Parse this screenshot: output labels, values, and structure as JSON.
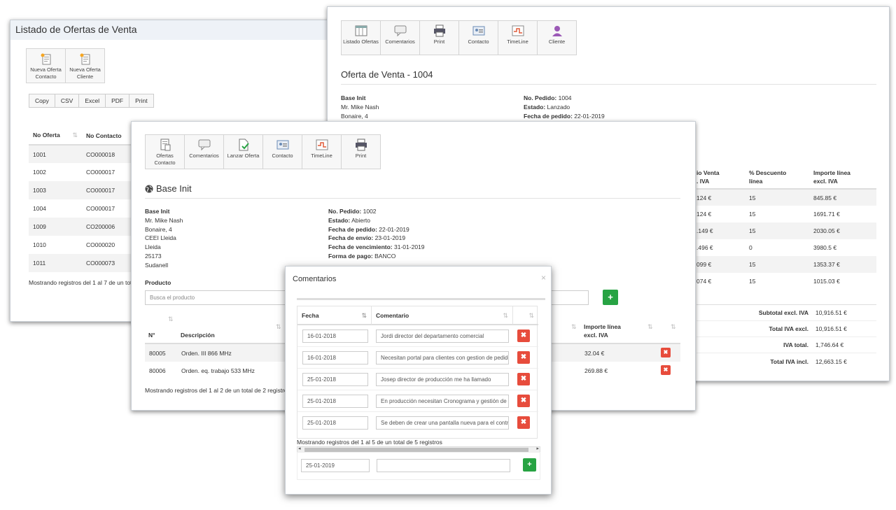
{
  "list_window": {
    "title": "Listado de Ofertas de Venta",
    "toolbar": [
      {
        "label": "Nueva Oferta Contacto",
        "icon": "new-offer-icon"
      },
      {
        "label": "Nueva Oferta Cliente",
        "icon": "new-offer-icon"
      }
    ],
    "export_buttons": [
      "Copy",
      "CSV",
      "Excel",
      "PDF",
      "Print"
    ],
    "columns": [
      "No Oferta",
      "No Contacto"
    ],
    "rows": [
      [
        "1001",
        "CO000018"
      ],
      [
        "1002",
        "CO000017"
      ],
      [
        "1003",
        "CO000017"
      ],
      [
        "1004",
        "CO000017"
      ],
      [
        "1009",
        "CO200006"
      ],
      [
        "1010",
        "CO000020"
      ],
      [
        "1011",
        "CO000073"
      ]
    ],
    "footer": "Mostrando registros del 1 al 7 de un total"
  },
  "offer_window": {
    "toolbar": [
      {
        "label": "Listado Ofertas",
        "icon": "list-icon"
      },
      {
        "label": "Comentarios",
        "icon": "comment-icon"
      },
      {
        "label": "Print",
        "icon": "printer-icon"
      },
      {
        "label": "Contacto",
        "icon": "contact-card-icon"
      },
      {
        "label": "TimeLine",
        "icon": "timeline-icon"
      },
      {
        "label": "Cliente",
        "icon": "user-icon"
      }
    ],
    "title": "Oferta de Venta - 1004",
    "left_info": [
      "Base Init",
      "Mr. Mike Nash",
      "Bonaire, 4"
    ],
    "right_info": [
      {
        "k": "No. Pedido:",
        "v": "1004"
      },
      {
        "k": "Estado:",
        "v": "Lanzado"
      },
      {
        "k": "Fecha de pedido:",
        "v": "22-01-2019"
      }
    ],
    "columns": [
      "io Venta . IVA",
      "% Descuento línea",
      "Importe línea excl. IVA"
    ],
    "col_heads": [
      [
        "io Venta",
        ". IVA"
      ],
      [
        "% Descuento",
        "línea"
      ],
      [
        "Importe línea",
        "excl. IVA"
      ]
    ],
    "rows": [
      [
        "124 €",
        "15",
        "845.85 €"
      ],
      [
        "124 €",
        "15",
        "1691.71 €"
      ],
      [
        ".149 €",
        "15",
        "2030.05 €"
      ],
      [
        ".496 €",
        "0",
        "3980.5 €"
      ],
      [
        "099 €",
        "15",
        "1353.37 €"
      ],
      [
        "074 €",
        "15",
        "1015.03 €"
      ]
    ],
    "totals": [
      {
        "label": "Subtotal excl. IVA",
        "value": "10,916.51 €"
      },
      {
        "label": "Total IVA excl.",
        "value": "10,916.51 €"
      },
      {
        "label": "IVA total.",
        "value": "1,746.64 €"
      },
      {
        "label": "Total IVA incl.",
        "value": "12,663.15 €"
      }
    ]
  },
  "contact_window": {
    "toolbar": [
      {
        "label": "Ofertas Contacto",
        "icon": "offers-icon"
      },
      {
        "label": "Comentarios",
        "icon": "comment-icon"
      },
      {
        "label": "Lanzar Oferta",
        "icon": "launch-document-icon"
      },
      {
        "label": "Contacto",
        "icon": "contact-card-icon"
      },
      {
        "label": "TimeLine",
        "icon": "timeline-icon"
      },
      {
        "label": "Print",
        "icon": "printer-icon"
      }
    ],
    "title": "Base Init",
    "left_info": [
      "Base Init",
      "Mr. Mike Nash",
      "Bonaire, 4",
      "CEEI Lleida",
      "Lleida",
      "25173",
      "Sudanell"
    ],
    "right_info": [
      {
        "k": "No. Pedido:",
        "v": "1002"
      },
      {
        "k": "Estado:",
        "v": "Abierto"
      },
      {
        "k": "Fecha de pedido:",
        "v": "22-01-2019"
      },
      {
        "k": "Fecha de envío:",
        "v": "23-01-2019"
      },
      {
        "k": "Fecha de vencimiento:",
        "v": "31-01-2019"
      },
      {
        "k": "Forma de pago:",
        "v": "BANCO"
      }
    ],
    "product_label": "Producto",
    "product_placeholder": "Busca el producto",
    "columns": {
      "num": "N°",
      "desc": "Descripción",
      "importe": "Importe línea excl. IVA"
    },
    "importe_head": [
      "Importe línea",
      "excl. IVA"
    ],
    "rows": [
      {
        "num": "80005",
        "desc": "Orden. III 866 MHz",
        "importe": "32.04 €"
      },
      {
        "num": "80006",
        "desc": "Orden. eq. trabajo 533 MHz",
        "importe": "269.88 €"
      }
    ],
    "footer": "Mostrando registros del 1 al 2 de un total de 2 registros"
  },
  "comments_dialog": {
    "title": "Comentarios",
    "close": "×",
    "columns": [
      "Fecha",
      "Comentario"
    ],
    "rows": [
      {
        "date": "16-01-2018",
        "comment": "Jordi director del departamento comercial"
      },
      {
        "date": "16-01-2018",
        "comment": "Necesitan portal para clientes con gestion de pedidos y e"
      },
      {
        "date": "25-01-2018",
        "comment": "Josep director de producción me ha llamado"
      },
      {
        "date": "25-01-2018",
        "comment": "En producción necesitan Cronograma y gestión de OP"
      },
      {
        "date": "25-01-2018",
        "comment": "Se deben de crear una pantalla nueva para el control de"
      }
    ],
    "footer": "Mostrando registros del 1 al 5 de un total de 5 registros",
    "new_date": "25-01-2019",
    "new_comment": ""
  },
  "colors": {
    "danger": "#e74c3c",
    "success": "#27a343"
  }
}
